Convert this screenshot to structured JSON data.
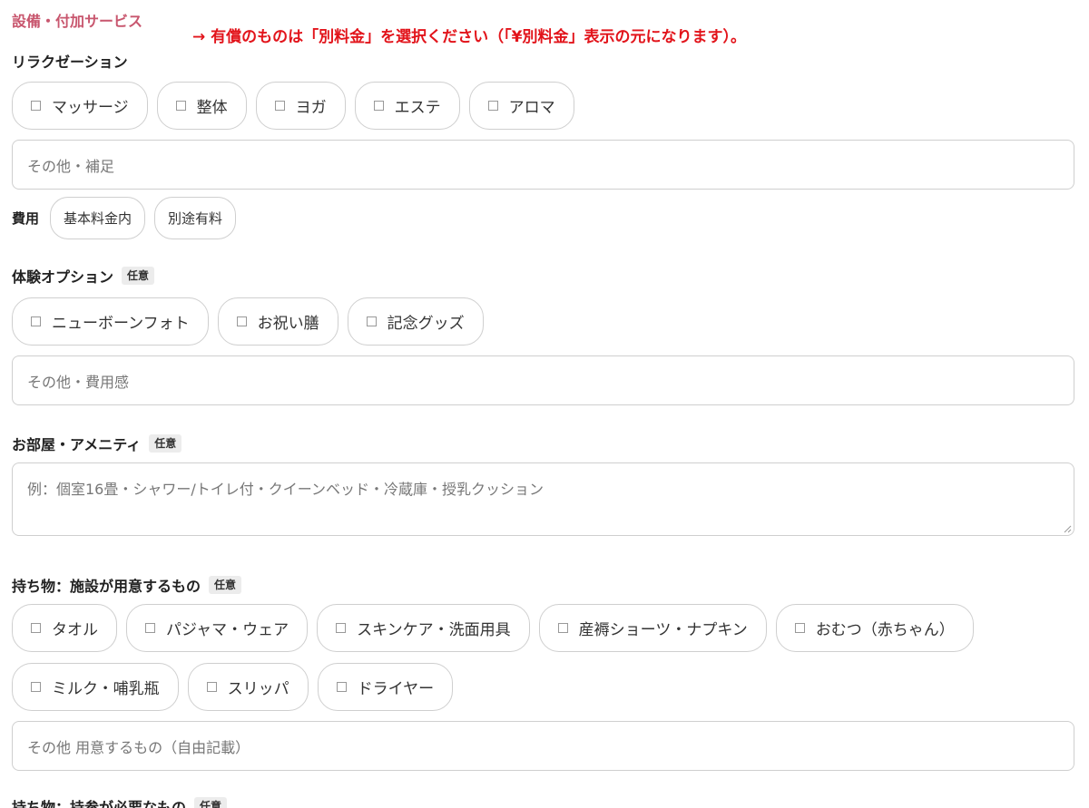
{
  "section_title": "設備・付加サービス",
  "note": "→ 有償のものは「別料金」を選択ください（「¥別料金」表示の元になります）。",
  "relaxation": {
    "label": "リラクゼーション",
    "options": [
      "マッサージ",
      "整体",
      "ヨガ",
      "エステ",
      "アロマ"
    ],
    "other_placeholder": "その他・補足",
    "cost_label": "費用",
    "cost_options": [
      "基本料金内",
      "別途有料"
    ]
  },
  "experience": {
    "label": "体験オプション",
    "badge": "任意",
    "options": [
      "ニューボーンフォト",
      "お祝い膳",
      "記念グッズ"
    ],
    "other_placeholder": "その他・費用感"
  },
  "room": {
    "label": "お部屋・アメニティ",
    "badge": "任意",
    "placeholder": "例：個室16畳・シャワー/トイレ付・クイーンベッド・冷蔵庫・授乳クッション"
  },
  "facility_items": {
    "label": "持ち物：施設が用意するもの",
    "badge": "任意",
    "options_row1": [
      "タオル",
      "パジャマ・ウェア",
      "スキンケア・洗面用具",
      "産褥ショーツ・ナプキン",
      "おむつ（赤ちゃん）"
    ],
    "options_row2": [
      "ミルク・哺乳瓶",
      "スリッパ",
      "ドライヤー"
    ],
    "other_placeholder": "その他 用意するもの（自由記載）"
  },
  "bring_items": {
    "label": "持ち物：持参が必要なもの",
    "badge": "任意"
  }
}
